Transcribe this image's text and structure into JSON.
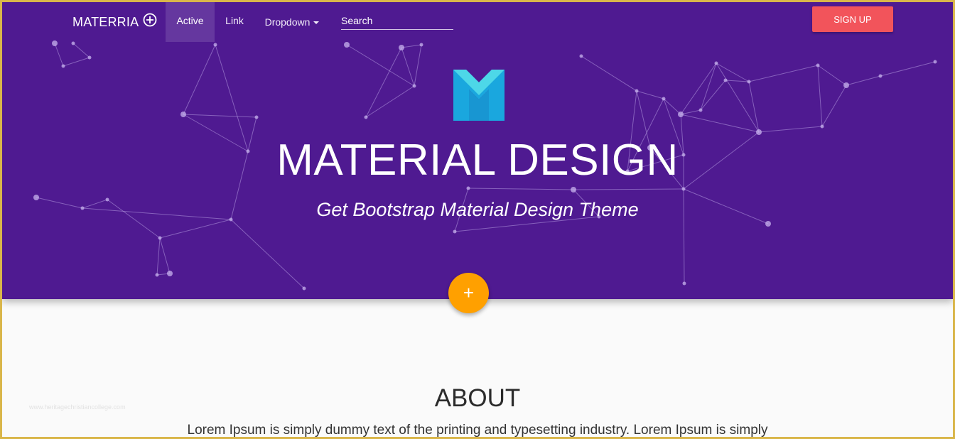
{
  "navbar": {
    "brand": "MATERRIA",
    "brand_icon": "plus-circle-icon",
    "items": [
      {
        "label": "Active",
        "active": true
      },
      {
        "label": "Link"
      },
      {
        "label": "Dropdown",
        "icon": "caret-down-icon"
      }
    ],
    "search_placeholder": "Search",
    "signup_label": "SIGN UP"
  },
  "hero": {
    "logo": "m-logo",
    "title": "MATERIAL DESIGN",
    "subtitle": "Get Bootstrap Material Design Theme",
    "fab_label": "+"
  },
  "watermark": "www.heritagechristiancollege.com",
  "about": {
    "title": "ABOUT",
    "text": "Lorem Ipsum is simply dummy text of the printing and typesetting industry. Lorem Ipsum is simply"
  },
  "colors": {
    "hero_background": "#4f1a91",
    "signup_button": "#f2545b",
    "fab": "#ffa000",
    "logo_light": "#4dd7e8",
    "logo_dark": "#1aa7de",
    "page_background": "#fafafa",
    "frame_border": "#d9b64a"
  }
}
